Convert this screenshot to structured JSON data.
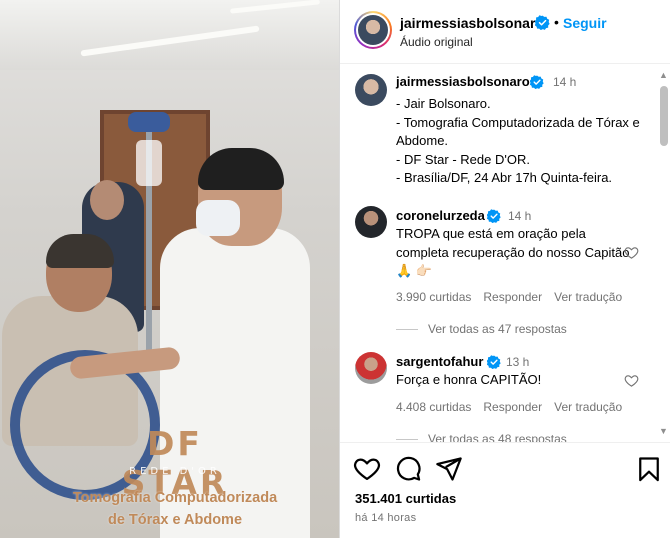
{
  "media": {
    "watermark_brand": "DF STAR",
    "watermark_sub": "REDE D'OR",
    "overlay_line1": "Tomografia Computadorizada",
    "overlay_line2": "de Tórax e Abdome"
  },
  "header": {
    "username": "jairmessiasbolsonaro",
    "follow_label": "Seguir",
    "separator": "•",
    "audio_label": "Áudio original",
    "more_label": "···"
  },
  "caption": {
    "username": "jairmessiasbolsonaro",
    "time": "14 h",
    "text": "- Jair Bolsonaro.\n- Tomografia Computadorizada de Tórax e Abdome.\n- DF Star - Rede D'OR.\n- Brasília/DF, 24 Abr 17h Quinta-feira."
  },
  "comments": [
    {
      "username": "coronelurzeda",
      "time": "14 h",
      "text": "TROPA que está em oração pela completa recuperação do nosso Capitão 🙏 👉🏻",
      "likes": "3.990 curtidas",
      "reply_label": "Responder",
      "translate_label": "Ver tradução",
      "view_replies": "Ver todas as 47 respostas"
    },
    {
      "username": "sargentofahur",
      "time": "13 h",
      "text": "Força e honra CAPITÃO!",
      "likes": "4.408 curtidas",
      "reply_label": "Responder",
      "translate_label": "Ver tradução",
      "view_replies": "Ver todas as 48 respostas"
    }
  ],
  "actions": {
    "likes": "351.401 curtidas",
    "time_ago": "há 14 horas"
  },
  "colors": {
    "link_blue": "#0095f6",
    "verified_blue": "#0095f6",
    "muted_text": "#737373",
    "watermark_copper": "#c08a5a"
  },
  "icons": [
    "verified-badge-icon",
    "heart-icon",
    "comment-icon",
    "share-icon",
    "bookmark-icon",
    "scroll-up-icon",
    "scroll-down-icon"
  ]
}
